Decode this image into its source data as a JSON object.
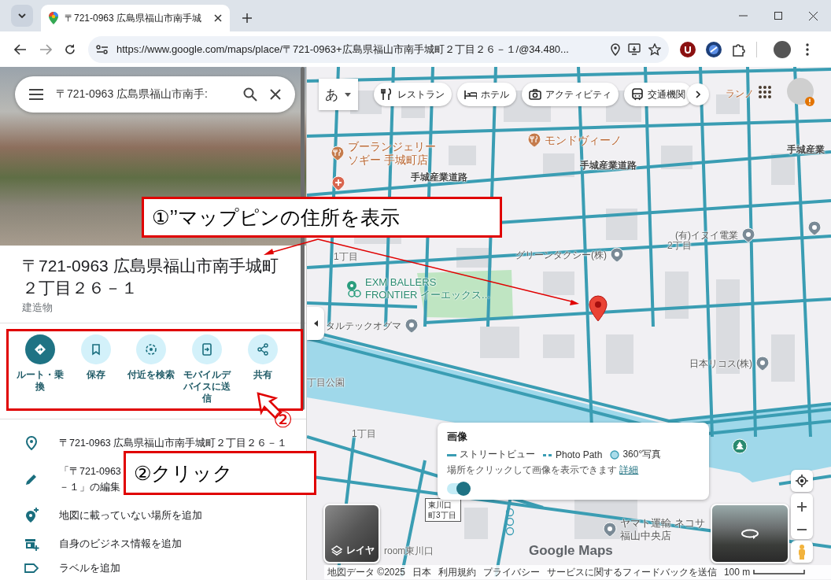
{
  "browser": {
    "tab": {
      "title": "〒721-0963 広島県福山市南手城",
      "selected": true
    },
    "url": "https://www.google.com/maps/place/〒721-0963+広島県福山市南手城町２丁目２６－１/@34.480..."
  },
  "sidebar": {
    "search_value": "〒721-0963 広島県福山市南手:",
    "title": "〒721-0963 広島県福山市南手城町２丁目２６－１",
    "category": "建造物",
    "actions": [
      {
        "label": "ルート・乗換",
        "kind": "directions",
        "primary": true
      },
      {
        "label": "保存",
        "kind": "save",
        "primary": false
      },
      {
        "label": "付近を検索",
        "kind": "nearby",
        "primary": false
      },
      {
        "label": "モバイルデバイスに送信",
        "kind": "send",
        "primary": false
      },
      {
        "label": "共有",
        "kind": "share",
        "primary": false
      }
    ],
    "details": [
      {
        "kind": "place",
        "text": "〒721-0963 広島県福山市南手城町２丁目２６－１"
      },
      {
        "kind": "edit",
        "lines": [
          "「〒721-0963",
          "－１」の編集"
        ]
      },
      {
        "kind": "add-place",
        "text": "地図に載っていない場所を追加"
      },
      {
        "kind": "business",
        "text": "自身のビジネス情報を追加"
      },
      {
        "kind": "label",
        "text": "ラベルを追加"
      }
    ]
  },
  "map": {
    "input_mode": "あ",
    "categories": [
      {
        "label": "レストラン",
        "kind": "restaurant"
      },
      {
        "label": "ホテル",
        "kind": "hotel"
      },
      {
        "label": "アクティビティ",
        "kind": "camera"
      },
      {
        "label": "交通機関",
        "kind": "transit"
      }
    ],
    "labels": [
      {
        "text": "ランノ",
        "kind": "food-text"
      },
      {
        "text": "ブーランジェリーソギー 手城町店",
        "kind": "food"
      },
      {
        "text": "モンドヴィーノ",
        "kind": "food"
      },
      {
        "text": "手城産業道路",
        "kind": "road"
      },
      {
        "text": "手城産業道路",
        "kind": "road"
      },
      {
        "text": "手城産業",
        "kind": "road"
      },
      {
        "text": "(有)イヌイ電業",
        "kind": "poi"
      },
      {
        "text": "2丁目",
        "kind": "area"
      },
      {
        "text": "1丁目",
        "kind": "area"
      },
      {
        "text": "グリーンタクシー(株)",
        "kind": "poi"
      },
      {
        "text": "EXM BALLERS\nFRONTIER イーエックス...",
        "kind": "green"
      },
      {
        "text": "タルテックオグマ",
        "kind": "poi"
      },
      {
        "text": "日本リコス(株)",
        "kind": "poi"
      },
      {
        "text": "丁目公園",
        "kind": "area"
      },
      {
        "text": "1丁目",
        "kind": "area"
      },
      {
        "text": "ヤマト運輸 ネコサ福山中央店",
        "kind": "poi-left"
      },
      {
        "text": "room東川口",
        "kind": "area"
      }
    ],
    "stop_sign": "東川口町3丁目",
    "imagery": {
      "title": "画像",
      "legend": [
        {
          "label": "ストリートビュー",
          "kind": "line"
        },
        {
          "label": "Photo Path",
          "kind": "dots"
        },
        {
          "label": "360°写真",
          "kind": "circle"
        }
      ],
      "hint": "場所をクリックして画像を表示できます",
      "link": "詳細",
      "toggle_on": true
    },
    "layers_label": "レイヤ",
    "logo": "Google Maps",
    "footer": [
      "地図データ ©2025",
      "日本",
      "利用規約",
      "プライバシー",
      "サービスに関するフィードバックを送信"
    ],
    "scale": "100 m"
  },
  "annotations": {
    "callout": "①’’マップピンの住所を表示",
    "step_badge": "②",
    "step_label": "②クリック"
  }
}
